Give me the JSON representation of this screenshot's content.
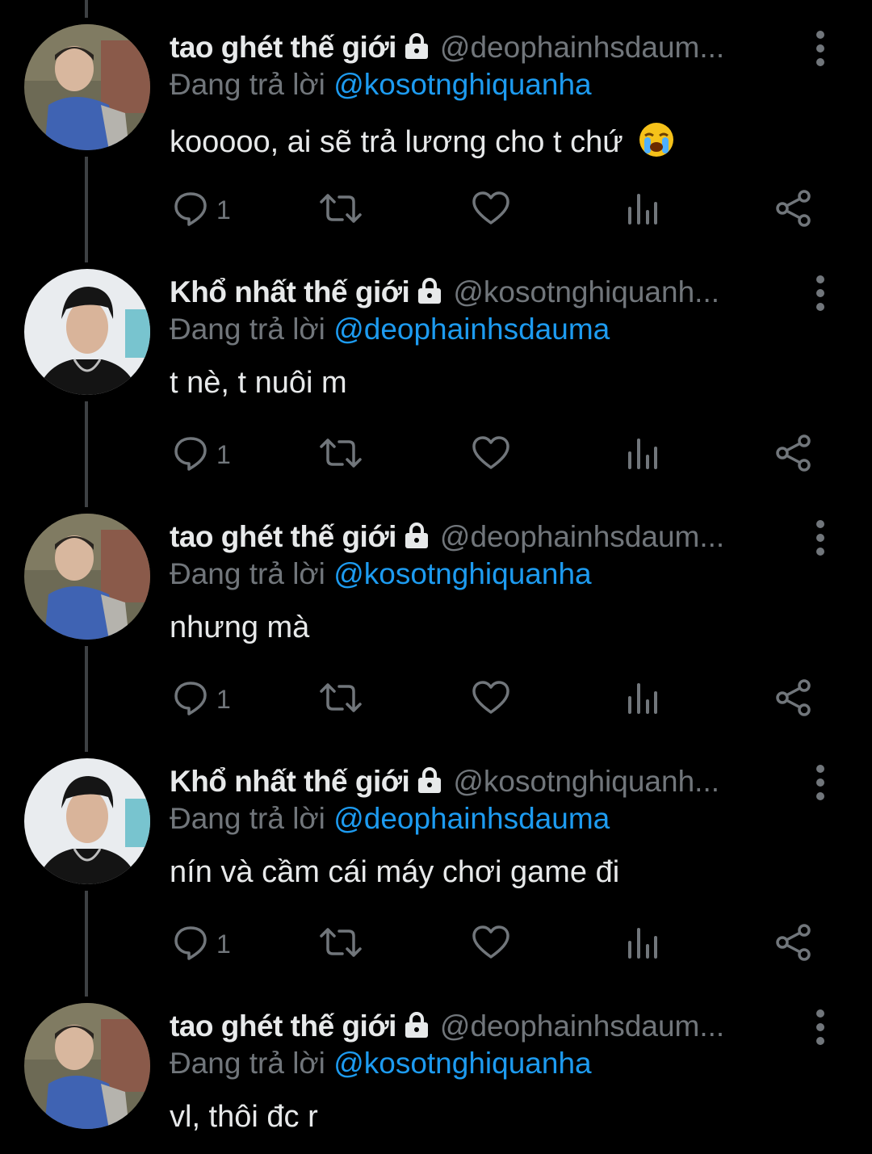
{
  "colors": {
    "background": "#000000",
    "text": "#e7e9ea",
    "muted": "#71767b",
    "accent": "#1d9bf0"
  },
  "reply_prefix": "Đang trả lời",
  "tweets": [
    {
      "name": "tao ghét thế giới",
      "handle": "@deophainhsdaum...",
      "reply_to": "@kosotnghiquanha",
      "text": "kooooo, ai sẽ trả lương cho t chứ",
      "reply_count": "1",
      "avatar": "child"
    },
    {
      "name": "Khổ nhất thế giới",
      "handle": "@kosotnghiquanh...",
      "reply_to": "@deophainhsdauma",
      "text": "t nè, t nuôi m",
      "reply_count": "1",
      "avatar": "man"
    },
    {
      "name": "tao ghét thế giới",
      "handle": "@deophainhsdaum...",
      "reply_to": "@kosotnghiquanha",
      "text": "nhưng mà",
      "reply_count": "1",
      "avatar": "child"
    },
    {
      "name": "Khổ nhất thế giới",
      "handle": "@kosotnghiquanh...",
      "reply_to": "@deophainhsdauma",
      "text": "nín và cầm cái máy chơi game đi",
      "reply_count": "1",
      "avatar": "man"
    },
    {
      "name": "tao ghét thế giới",
      "handle": "@deophainhsdaum...",
      "reply_to": "@kosotnghiquanha",
      "text": "vl, thôi đc r",
      "reply_count": "",
      "avatar": "child"
    }
  ],
  "icons": [
    "lock-icon",
    "more-icon",
    "reply-icon",
    "retweet-icon",
    "like-icon",
    "views-icon",
    "share-icon",
    "crying-emoji-icon"
  ]
}
